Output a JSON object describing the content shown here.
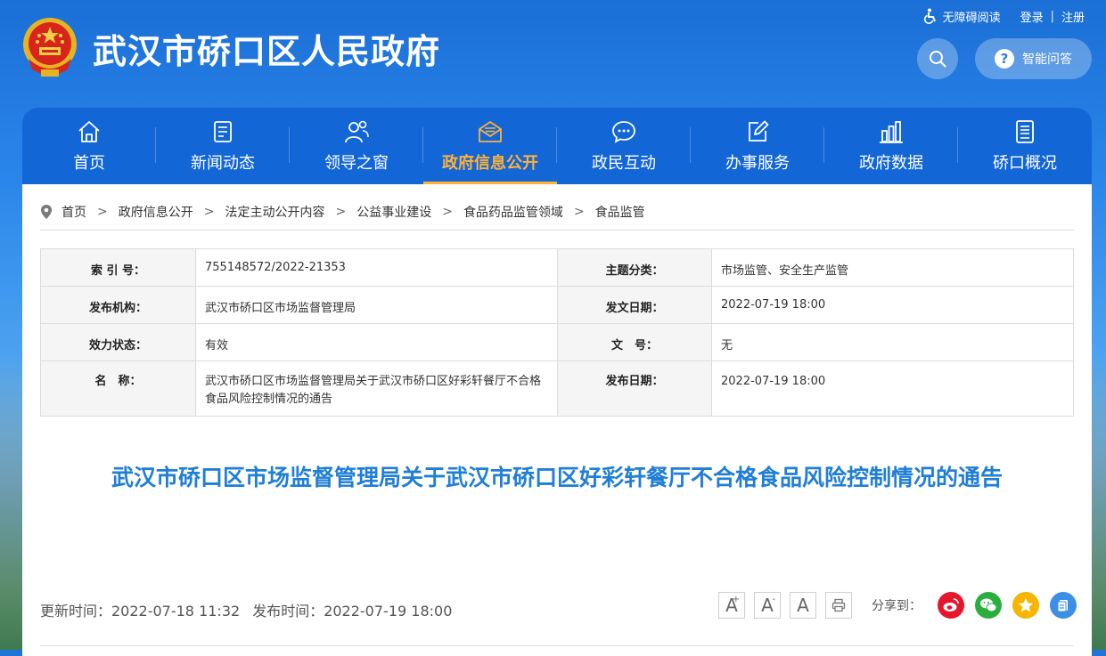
{
  "header": {
    "title": "武汉市硚口区人民政府",
    "accessibility": "无障碍阅读",
    "login": "登录",
    "separator": "|",
    "register": "注册",
    "qa": "智能问答"
  },
  "nav": [
    {
      "label": "首页",
      "icon": "home-icon"
    },
    {
      "label": "新闻动态",
      "icon": "news-icon"
    },
    {
      "label": "领导之窗",
      "icon": "leaders-icon"
    },
    {
      "label": "政府信息公开",
      "icon": "mail-open-icon"
    },
    {
      "label": "政民互动",
      "icon": "chat-icon"
    },
    {
      "label": "办事服务",
      "icon": "edit-icon"
    },
    {
      "label": "政府数据",
      "icon": "bar-chart-icon"
    },
    {
      "label": "硚口概况",
      "icon": "document-icon"
    }
  ],
  "nav_active_index": 3,
  "breadcrumb": [
    "首页",
    "政府信息公开",
    "法定主动公开内容",
    "公益事业建设",
    "食品药品监管领域",
    "食品监管"
  ],
  "breadcrumb_sep": ">",
  "meta": {
    "index_no_label": "索 引 号：",
    "index_no": "755148572/2022-21353",
    "topic_label": "主题分类：",
    "topic": "市场监管、安全生产监管",
    "agency_label": "发布机构：",
    "agency": "武汉市硚口区市场监督管理局",
    "doc_date_label": "发文日期：",
    "doc_date": "2022-07-19 18:00",
    "status_label": "效力状态：",
    "status": "有效",
    "doc_no_label": "文　号：",
    "doc_no": "无",
    "name_label": "名　称：",
    "name": "武汉市硚口区市场监督管理局关于武汉市硚口区好彩轩餐厅不合格食品风险控制情况的通告",
    "pub_date_label": "发布日期：",
    "pub_date": "2022-07-19 18:00"
  },
  "article": {
    "title": "武汉市硚口区市场监督管理局关于武汉市硚口区好彩轩餐厅不合格食品风险控制情况的通告",
    "updated": "更新时间：2022-07-18 11:32",
    "published": "发布时间：2022-07-19 18:00"
  },
  "tools": {
    "font_up": "A",
    "font_up_sup": "+",
    "font_down": "A",
    "font_down_sup": "-",
    "font_reset": "A",
    "share_label": "分享到："
  },
  "colors": {
    "nav_bg": "#1366d6",
    "active": "#ffb238",
    "title": "#1f7ed6",
    "weibo": "#e6162d",
    "wechat": "#2aae3d",
    "qzone": "#f5b500",
    "other": "#3b8fe6"
  }
}
